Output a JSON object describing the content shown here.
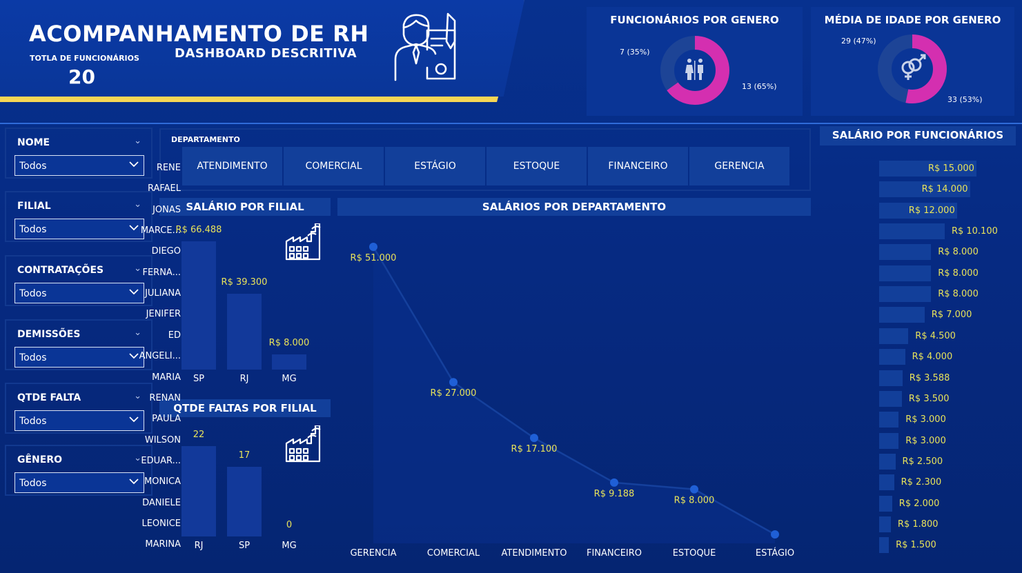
{
  "header": {
    "title": "ACOMPANHAMENTO DE RH",
    "subtitle": "DASHBOARD DESCRITIVA",
    "total_label": "TOTLA DE FUNCIONÁRIOS",
    "total_value": "20",
    "colors": {
      "accent_stripe": "#f7d654",
      "primary": "#0a3698"
    }
  },
  "gender_card": {
    "title": "FUNCIONÁRIOS POR GENERO",
    "label_a": "7 (35%)",
    "label_b": "13 (65%)",
    "chart_data": {
      "type": "pie",
      "values": [
        7,
        13
      ],
      "percent": [
        35,
        65
      ],
      "colors": [
        "#1f4aa8",
        "#d42fb0"
      ]
    },
    "icon": "male-female-restroom-icon"
  },
  "age_card": {
    "title": "MÉDIA DE IDADE POR GENERO",
    "label_a": "29 (47%)",
    "label_b": "33 (53%)",
    "chart_data": {
      "type": "pie",
      "values": [
        29,
        33
      ],
      "percent": [
        47,
        53
      ],
      "colors": [
        "#1f4aa8",
        "#d42fb0"
      ]
    },
    "icon": "gender-symbol-icon"
  },
  "filters": [
    {
      "label": "NOME",
      "value": "Todos"
    },
    {
      "label": "FILIAL",
      "value": "Todos"
    },
    {
      "label": "CONTRATAÇÕES",
      "value": "Todos"
    },
    {
      "label": "DEMISSÕES",
      "value": "Todos"
    },
    {
      "label": "QTDE FALTA",
      "value": "Todos"
    },
    {
      "label": "GÊNERO",
      "value": "Todos"
    }
  ],
  "department": {
    "label": "DEPARTAMENTO",
    "options": [
      "ATENDIMENTO",
      "COMERCIAL",
      "ESTÁGIO",
      "ESTOQUE",
      "FINANCEIRO",
      "GERENCIA"
    ]
  },
  "salario_filial": {
    "title": "SALÁRIO POR FILIAL",
    "chart_data": {
      "type": "bar",
      "categories": [
        "SP",
        "RJ",
        "MG"
      ],
      "values": [
        66488,
        39300,
        8000
      ],
      "labels": [
        "R$ 66.488",
        "R$ 39.300",
        "R$ 8.000"
      ]
    }
  },
  "faltas_filial": {
    "title": "QTDE FALTAS POR FILIAL",
    "chart_data": {
      "type": "bar",
      "categories": [
        "RJ",
        "SP",
        "MG"
      ],
      "values": [
        22,
        17,
        0
      ],
      "labels": [
        "22",
        "17",
        "0"
      ]
    }
  },
  "salario_departamento": {
    "title": "SALÁRIOS POR DEPARTAMENTO",
    "chart_data": {
      "type": "area",
      "categories": [
        "GERENCIA",
        "COMERCIAL",
        "ATENDIMENTO",
        "FINANCEIRO",
        "ESTOQUE",
        "ESTÁGIO"
      ],
      "values": [
        51000,
        27000,
        17100,
        9188,
        8000,
        0
      ],
      "labels": [
        "R$ 51.000",
        "R$ 27.000",
        "R$ 17.100",
        "R$ 9.188",
        "R$ 8.000",
        ""
      ]
    }
  },
  "salario_funcionarios": {
    "title": "SALÁRIO POR FUNCIONÁRIOS",
    "chart_data": {
      "type": "bar",
      "categories": [
        "RENE",
        "RAFAEL",
        "JONAS",
        "MARCE...",
        "DIEGO",
        "FERNA...",
        "JULIANA",
        "JENIFER",
        "ED",
        "ANGELI...",
        "MARIA",
        "RENAN",
        "PAULA",
        "WILSON",
        "EDUAR...",
        "MONICA",
        "DANIELE",
        "LEONICE",
        "MARINA"
      ],
      "values": [
        15000,
        14000,
        12000,
        10100,
        8000,
        8000,
        8000,
        7000,
        4500,
        4000,
        3588,
        3500,
        3000,
        3000,
        2500,
        2300,
        2000,
        1800,
        1500
      ],
      "labels": [
        "R$ 15.000",
        "R$ 14.000",
        "R$ 12.000",
        "R$ 10.100",
        "R$ 8.000",
        "R$ 8.000",
        "R$ 8.000",
        "R$ 7.000",
        "R$ 4.500",
        "R$ 4.000",
        "R$ 3.588",
        "R$ 3.500",
        "R$ 3.000",
        "R$ 3.000",
        "R$ 2.500",
        "R$ 2.300",
        "R$ 2.000",
        "R$ 1.800",
        "R$ 1.500"
      ]
    }
  }
}
